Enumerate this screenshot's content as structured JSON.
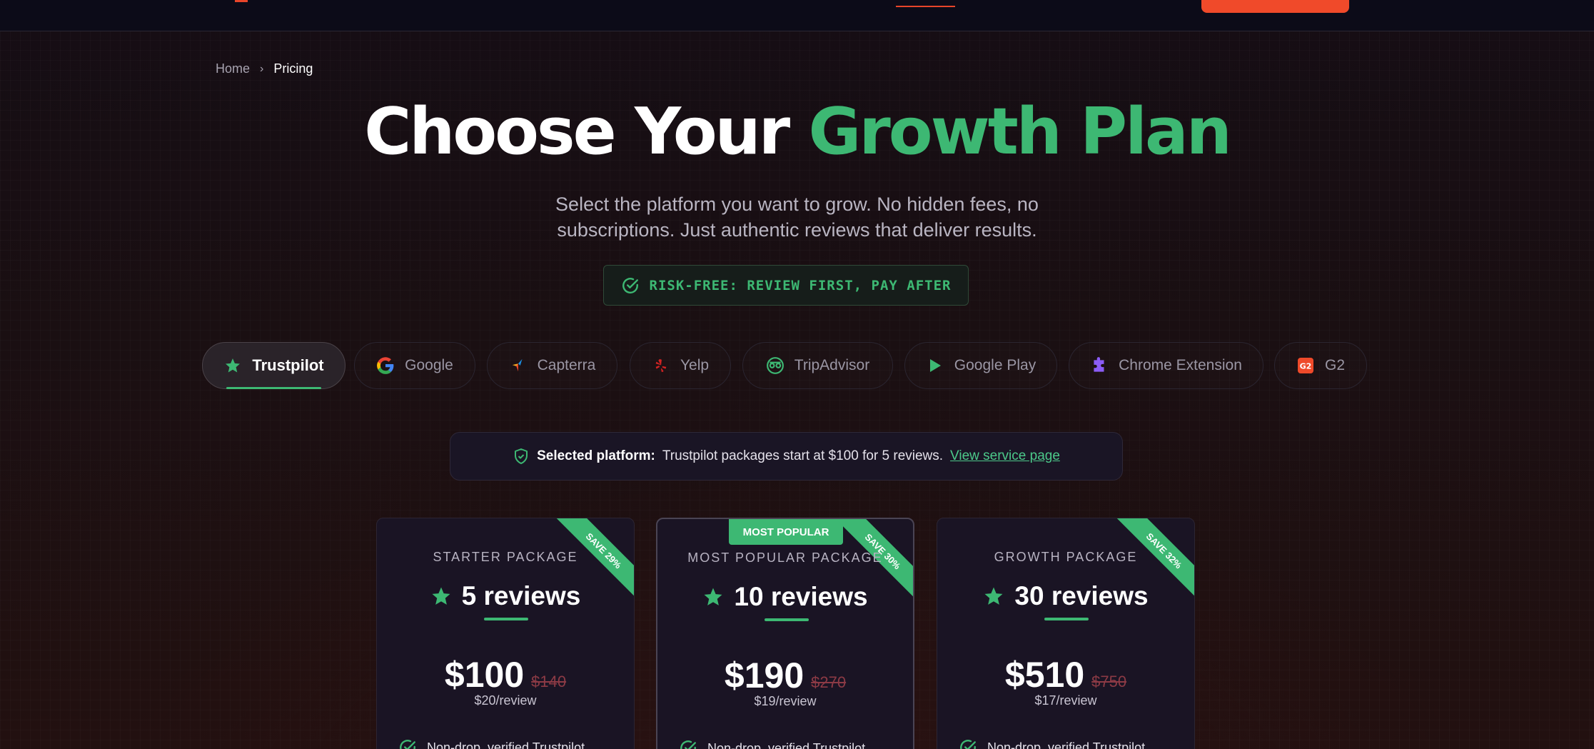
{
  "breadcrumb": {
    "home": "Home",
    "current": "Pricing"
  },
  "hero": {
    "title_main": "Choose Your",
    "title_accent": "Growth Plan",
    "subtitle_line1": "Select the platform you want to grow. No hidden fees, no",
    "subtitle_line2": "subscriptions. Just authentic reviews that deliver results."
  },
  "risk_badge": {
    "text": "RISK-FREE: REVIEW FIRST, PAY AFTER"
  },
  "tabs": [
    {
      "label": "Trustpilot",
      "icon": "star-icon",
      "active": true
    },
    {
      "label": "Google",
      "icon": "google-icon",
      "active": false
    },
    {
      "label": "Capterra",
      "icon": "capterra-icon",
      "active": false
    },
    {
      "label": "Yelp",
      "icon": "yelp-icon",
      "active": false
    },
    {
      "label": "TripAdvisor",
      "icon": "tripadvisor-icon",
      "active": false
    },
    {
      "label": "Google Play",
      "icon": "play-icon",
      "active": false
    },
    {
      "label": "Chrome Extension",
      "icon": "puzzle-icon",
      "active": false
    },
    {
      "label": "G2",
      "icon": "g2-icon",
      "active": false
    }
  ],
  "selected_platform": {
    "label": "Selected platform:",
    "text": "Trustpilot packages start at $100 for 5 reviews.",
    "link": "View service page"
  },
  "packages": [
    {
      "label": "STARTER PACKAGE",
      "reviews": "5 reviews",
      "price": "$100",
      "old_price": "$140",
      "per_review": "$20/review",
      "save": "SAVE 29%",
      "badge": "",
      "feature": "Non-drop, verified Trustpilot"
    },
    {
      "label": "MOST POPULAR PACKAGE",
      "reviews": "10 reviews",
      "price": "$190",
      "old_price": "$270",
      "per_review": "$19/review",
      "save": "SAVE 30%",
      "badge": "MOST POPULAR",
      "feature": "Non-drop, verified Trustpilot"
    },
    {
      "label": "GROWTH PACKAGE",
      "reviews": "30 reviews",
      "price": "$510",
      "old_price": "$750",
      "per_review": "$17/review",
      "save": "SAVE 32%",
      "badge": "",
      "feature": "Non-drop, verified Trustpilot"
    }
  ],
  "colors": {
    "accent_green": "#3db873",
    "brand_orange": "#f04a2a",
    "background": "#150d14"
  }
}
